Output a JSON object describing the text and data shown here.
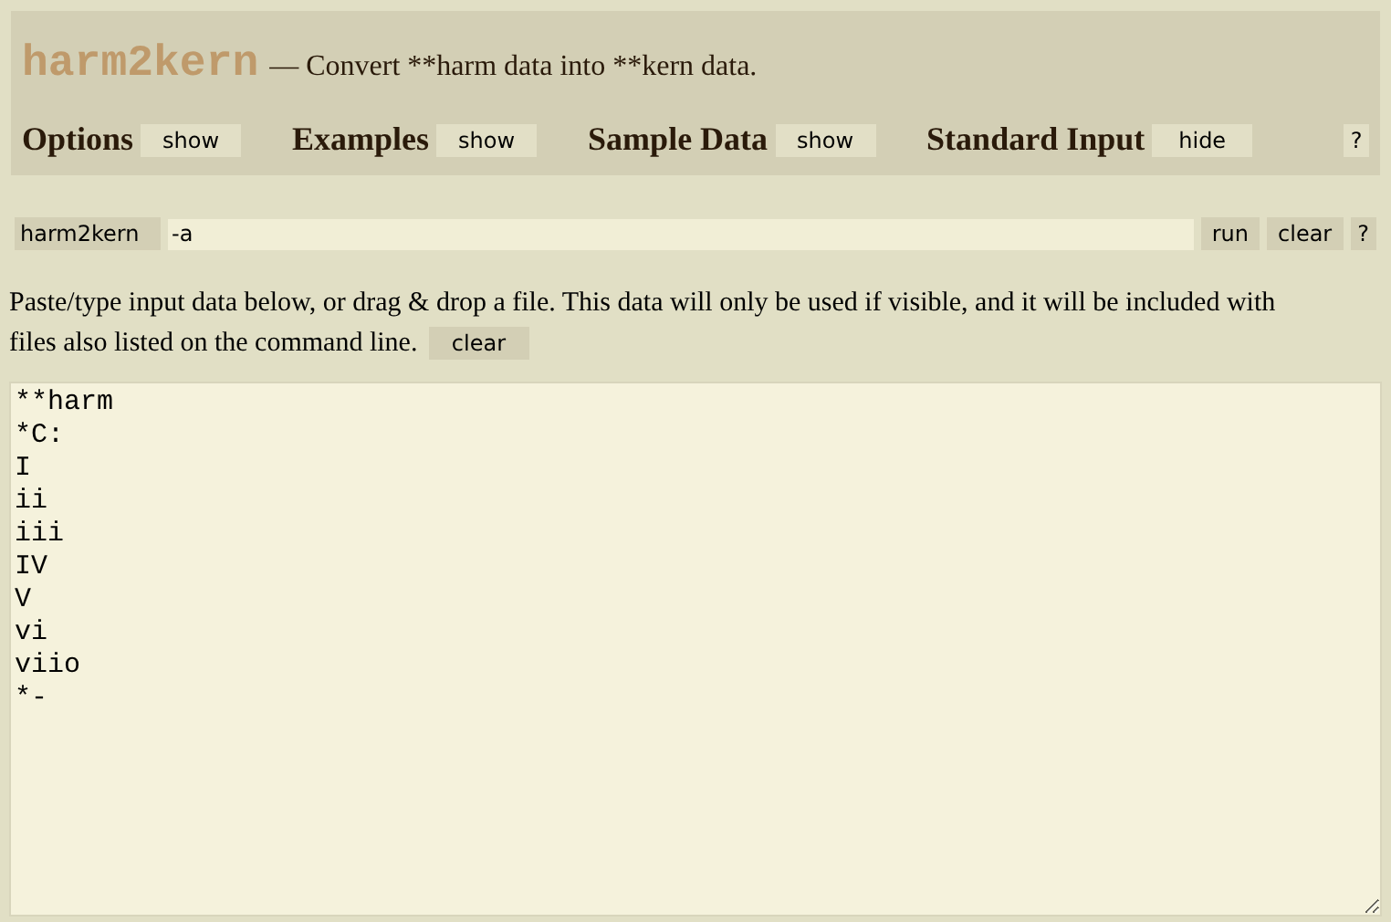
{
  "header": {
    "title": "harm2kern",
    "subtitle": "— Convert **harm data into **kern data."
  },
  "sections": [
    {
      "label": "Options",
      "button": "show"
    },
    {
      "label": "Examples",
      "button": "show"
    },
    {
      "label": "Sample Data",
      "button": "show"
    },
    {
      "label": "Standard Input",
      "button": "hide"
    }
  ],
  "help_button": "?",
  "command": {
    "program": "harm2kern",
    "value": "-a",
    "run": "run",
    "clear": "clear",
    "help": "?"
  },
  "instructions": {
    "lines": [
      "Paste/type input data below, or drag & drop a file. This data will only be used if visible, and it will be included with",
      "files also listed on the command line."
    ],
    "clear": "clear"
  },
  "input_data": [
    "**harm",
    "*C:",
    "I",
    "ii",
    "iii",
    "IV",
    "V",
    "vi",
    "viio",
    "*-"
  ]
}
